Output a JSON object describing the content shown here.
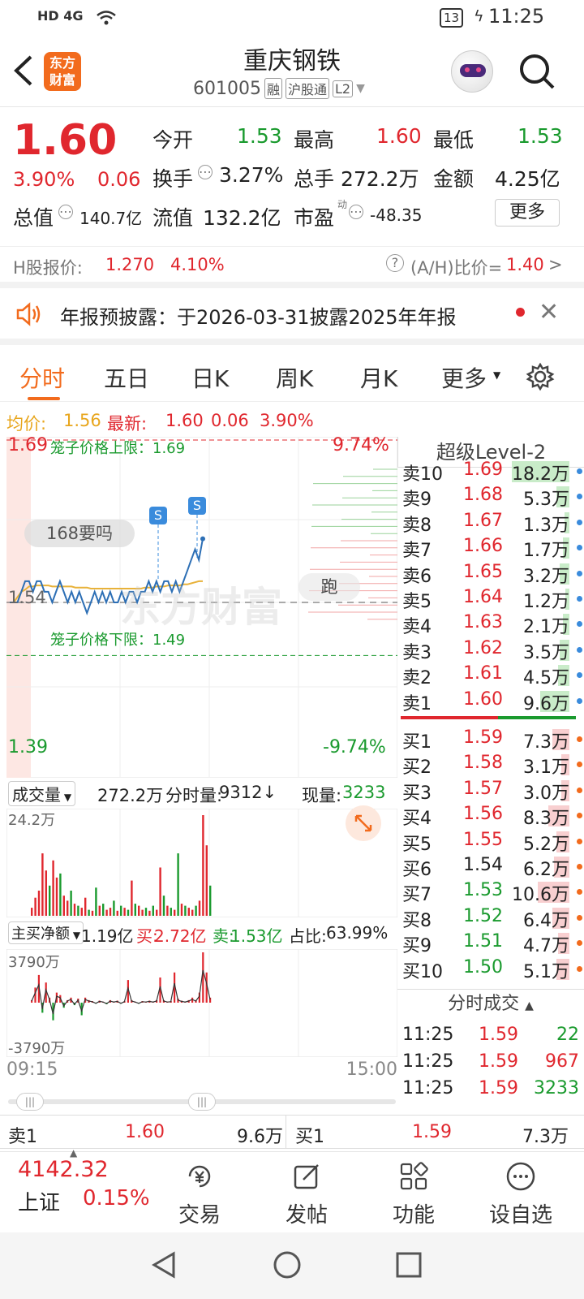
{
  "status": {
    "network": "HD 4G",
    "battery": "13",
    "time": "11:25"
  },
  "header": {
    "logo_line1": "东方",
    "logo_line2": "财富",
    "name": "重庆钢铁",
    "code": "601005",
    "badges": [
      "融",
      "沪股通",
      "L2"
    ]
  },
  "quote": {
    "price": "1.60",
    "change_pct": "3.90%",
    "change": "0.06",
    "stats": [
      {
        "label": "今开",
        "value": "1.53"
      },
      {
        "label": "最高",
        "value": "1.60"
      },
      {
        "label": "最低",
        "value": "1.53"
      },
      {
        "label": "换手",
        "value": "3.27%"
      },
      {
        "label": "总手",
        "value": "272.2万"
      },
      {
        "label": "金额",
        "value": "4.25亿"
      },
      {
        "label": "总值",
        "value": "140.7亿"
      },
      {
        "label": "流值",
        "value": "132.2亿"
      },
      {
        "label": "市盈",
        "value": "-48.35"
      }
    ],
    "pe_sup": "动",
    "more_label": "更多"
  },
  "hshare": {
    "label": "H股报价:",
    "price": "1.270",
    "pct": "4.10%",
    "ratio_label": "(A/H)比价=",
    "ratio": "1.40",
    "arrow": ">"
  },
  "notice": {
    "text": "年报预披露：于2026-03-31披露2025年年报"
  },
  "tabs": [
    "分时",
    "五日",
    "日K",
    "周K",
    "月K",
    "更多"
  ],
  "avg": {
    "label1": "均价:",
    "avg": "1.56",
    "label2": "最新:",
    "latest": "1.60",
    "chg": "0.06",
    "pct": "3.90%"
  },
  "chart": {
    "top_price": "1.69",
    "top_pct": "9.74%",
    "upper_label": "笼子价格上限：1.69",
    "mid_price": "1.54",
    "lower_label": "笼子价格下限：1.49",
    "bottom_price": "1.39",
    "bottom_pct": "-9.74%",
    "tooltip": "168要吗",
    "run_label": "跑",
    "watermark": "东方财富",
    "s_marker": "S"
  },
  "level2": {
    "title": "超级Level-2",
    "asks": [
      {
        "label": "卖10",
        "price": "1.69",
        "vol": "18.2万",
        "bar": 0.55
      },
      {
        "label": "卖9",
        "price": "1.68",
        "vol": "5.3万",
        "bar": 0.12
      },
      {
        "label": "卖8",
        "price": "1.67",
        "vol": "1.3万",
        "bar": 0.05
      },
      {
        "label": "卖7",
        "price": "1.66",
        "vol": "1.7万",
        "bar": 0.06
      },
      {
        "label": "卖6",
        "price": "1.65",
        "vol": "3.2万",
        "bar": 0.09
      },
      {
        "label": "卖5",
        "price": "1.64",
        "vol": "1.2万",
        "bar": 0.04
      },
      {
        "label": "卖4",
        "price": "1.63",
        "vol": "2.1万",
        "bar": 0.06
      },
      {
        "label": "卖3",
        "price": "1.62",
        "vol": "3.5万",
        "bar": 0.09
      },
      {
        "label": "卖2",
        "price": "1.61",
        "vol": "4.5万",
        "bar": 0.11
      },
      {
        "label": "卖1",
        "price": "1.60",
        "vol": "9.6万",
        "bar": 0.28
      }
    ],
    "bids": [
      {
        "label": "买1",
        "price": "1.59",
        "vol": "7.3万",
        "bar": 0.16
      },
      {
        "label": "买2",
        "price": "1.58",
        "vol": "3.1万",
        "bar": 0.08
      },
      {
        "label": "买3",
        "price": "1.57",
        "vol": "3.0万",
        "bar": 0.08
      },
      {
        "label": "买4",
        "price": "1.56",
        "vol": "8.3万",
        "bar": 0.2
      },
      {
        "label": "买5",
        "price": "1.55",
        "vol": "5.2万",
        "bar": 0.12
      },
      {
        "label": "买6",
        "price": "1.54",
        "vol": "6.2万",
        "bar": 0.15
      },
      {
        "label": "买7",
        "price": "1.53",
        "vol": "10.6万",
        "bar": 0.3
      },
      {
        "label": "买8",
        "price": "1.52",
        "vol": "6.4万",
        "bar": 0.16
      },
      {
        "label": "买9",
        "price": "1.51",
        "vol": "4.7万",
        "bar": 0.11
      },
      {
        "label": "买10",
        "price": "1.50",
        "vol": "5.1万",
        "bar": 0.12
      }
    ],
    "trades_title": "分时成交",
    "trades": [
      {
        "time": "11:25",
        "price": "1.59",
        "vol": "22"
      },
      {
        "time": "11:25",
        "price": "1.59",
        "vol": "967"
      },
      {
        "time": "11:25",
        "price": "1.59",
        "vol": "3233"
      }
    ]
  },
  "volume": {
    "selector": "成交量",
    "total": "272.2万",
    "tick_label": "分时量:",
    "tick": "9312↓",
    "now_label": "现量:",
    "now": "3233",
    "max": "24.2万"
  },
  "flow": {
    "selector": "主买净额",
    "net": "1.19亿",
    "buy_label": "买:",
    "buy": "2.72亿",
    "sell_label": "卖:",
    "sell": "1.53亿",
    "ratio_label": "占比:",
    "ratio": "63.99%",
    "max": "3790万",
    "min": "-3790万"
  },
  "time_axis": {
    "start": "09:15",
    "end": "15:00"
  },
  "bottom_quote": {
    "ask_label": "卖1",
    "ask_price": "1.60",
    "ask_vol": "9.6万",
    "bid_label": "买1",
    "bid_price": "1.59",
    "bid_vol": "7.3万"
  },
  "nav": {
    "index_value": "4142.32",
    "index_name": "上证",
    "index_pct": "0.15%",
    "items": [
      "交易",
      "发帖",
      "功能",
      "设自选"
    ]
  },
  "colors": {
    "up": "#e0272e",
    "down": "#1a9a2e",
    "price_line": "#2d6fb5",
    "avg_line": "#e8b23a",
    "accent": "#f26b1d"
  }
}
